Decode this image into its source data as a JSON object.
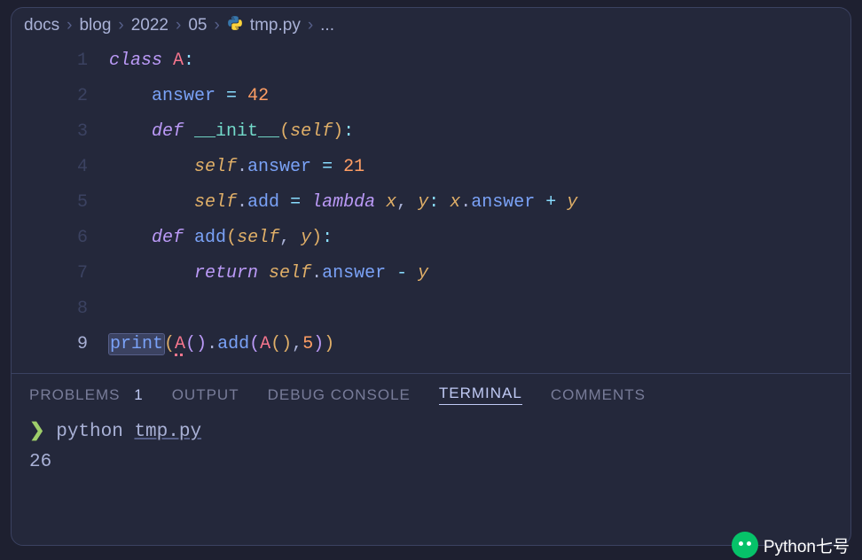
{
  "breadcrumb": {
    "parts": [
      "docs",
      "blog",
      "2022",
      "05"
    ],
    "file": "tmp.py",
    "sep": "›",
    "tail": "..."
  },
  "code": {
    "lines": [
      {
        "n": "1",
        "c": [
          [
            "kw",
            "class"
          ],
          [
            " "
          ],
          [
            "cls",
            "A"
          ],
          [
            "colon",
            ":"
          ]
        ]
      },
      {
        "n": "2",
        "c": [
          [
            "",
            "    "
          ],
          [
            "prop",
            "answer"
          ],
          [
            " "
          ],
          [
            "op",
            "="
          ],
          [
            " "
          ],
          [
            "num",
            "42"
          ]
        ]
      },
      {
        "n": "3",
        "c": [
          [
            "",
            "    "
          ],
          [
            "kw",
            "def"
          ],
          [
            " "
          ],
          [
            "dunder",
            "__init__"
          ],
          [
            "paren-y",
            "("
          ],
          [
            "param",
            "self"
          ],
          [
            "paren-y",
            ")"
          ],
          [
            "colon",
            ":"
          ]
        ]
      },
      {
        "n": "4",
        "c": [
          [
            "",
            "        "
          ],
          [
            "selfv",
            "self"
          ],
          [
            "punct",
            "."
          ],
          [
            "prop",
            "answer"
          ],
          [
            " "
          ],
          [
            "op",
            "="
          ],
          [
            " "
          ],
          [
            "num",
            "21"
          ]
        ]
      },
      {
        "n": "5",
        "c": [
          [
            "",
            "        "
          ],
          [
            "selfv",
            "self"
          ],
          [
            "punct",
            "."
          ],
          [
            "prop",
            "add"
          ],
          [
            " "
          ],
          [
            "op",
            "="
          ],
          [
            " "
          ],
          [
            "kw",
            "lambda"
          ],
          [
            " "
          ],
          [
            "param",
            "x"
          ],
          [
            "punct",
            ","
          ],
          [
            " "
          ],
          [
            "param",
            "y"
          ],
          [
            "colon",
            ":"
          ],
          [
            " "
          ],
          [
            "selfv",
            "x"
          ],
          [
            "punct",
            "."
          ],
          [
            "prop",
            "answer"
          ],
          [
            " "
          ],
          [
            "op",
            "+"
          ],
          [
            " "
          ],
          [
            "selfv",
            "y"
          ]
        ]
      },
      {
        "n": "6",
        "c": [
          [
            "",
            "    "
          ],
          [
            "kw",
            "def"
          ],
          [
            " "
          ],
          [
            "fn",
            "add"
          ],
          [
            "paren-y",
            "("
          ],
          [
            "param",
            "self"
          ],
          [
            "punct",
            ","
          ],
          [
            " "
          ],
          [
            "param",
            "y"
          ],
          [
            "paren-y",
            ")"
          ],
          [
            "colon",
            ":"
          ]
        ]
      },
      {
        "n": "7",
        "c": [
          [
            "",
            "        "
          ],
          [
            "ret",
            "return"
          ],
          [
            " "
          ],
          [
            "selfv",
            "self"
          ],
          [
            "punct",
            "."
          ],
          [
            "prop",
            "answer"
          ],
          [
            " "
          ],
          [
            "op",
            "-"
          ],
          [
            " "
          ],
          [
            "selfv",
            "y"
          ]
        ]
      },
      {
        "n": "8",
        "c": []
      },
      {
        "n": "9",
        "active": true,
        "c": [
          [
            "sel",
            "print"
          ],
          [
            "paren-y",
            "("
          ],
          [
            "err",
            "A"
          ],
          [
            "paren-p",
            "("
          ],
          [
            "paren-p",
            ")"
          ],
          [
            "punct",
            "."
          ],
          [
            "fn",
            "add"
          ],
          [
            "paren-p",
            "("
          ],
          [
            "cls",
            "A"
          ],
          [
            "paren-y",
            "("
          ],
          [
            "paren-y",
            ")"
          ],
          [
            "punct",
            ","
          ],
          [
            "num",
            "5"
          ],
          [
            "paren-p",
            ")"
          ],
          [
            "paren-y",
            ")"
          ]
        ]
      }
    ]
  },
  "tabs": {
    "problems": "PROBLEMS",
    "problems_count": "1",
    "output": "OUTPUT",
    "debug": "DEBUG CONSOLE",
    "terminal": "TERMINAL",
    "comments": "COMMENTS"
  },
  "terminal": {
    "prompt": "❯",
    "cmd": "python",
    "arg": "tmp.py",
    "output": "26"
  },
  "watermark": "Python七号"
}
